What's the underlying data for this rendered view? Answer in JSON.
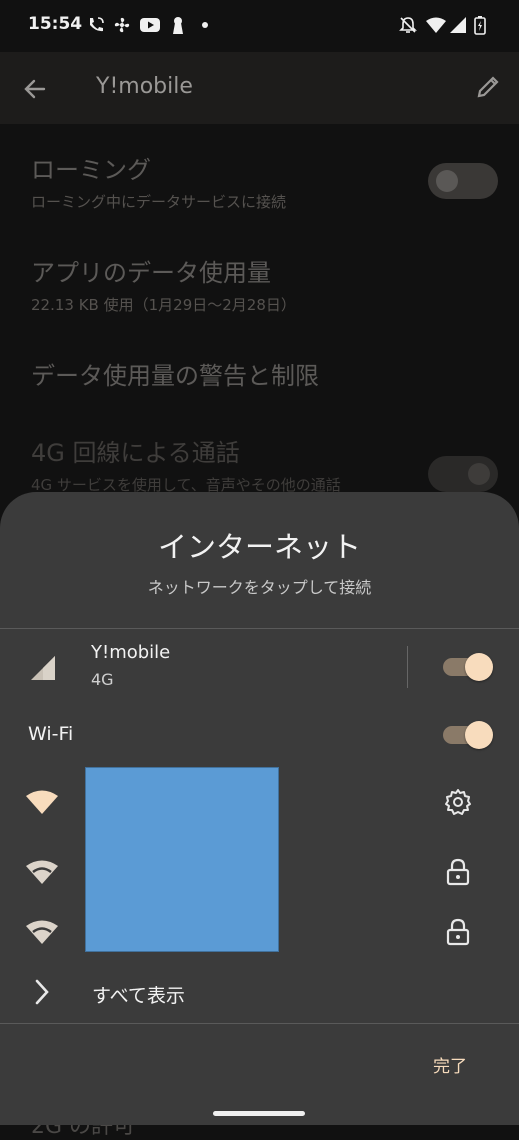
{
  "status_bar": {
    "time": "15:54",
    "left_icons": [
      "wifi-calling-icon",
      "fan-icon",
      "youtube-icon",
      "keyhole-icon",
      "dot-icon"
    ],
    "right_icons": [
      "notifications-off-icon",
      "wifi-icon",
      "cell-signal-icon",
      "battery-charging-icon"
    ]
  },
  "app_bar": {
    "title": "Y!mobile"
  },
  "settings": [
    {
      "title": "ローミング",
      "subtitle": "ローミング中にデータサービスに接続",
      "toggle": false
    },
    {
      "title": "アプリのデータ使用量",
      "subtitle": "22.13 KB 使用（1月29日〜2月28日）"
    },
    {
      "title": "データ使用量の警告と制限"
    },
    {
      "title": "4G 回線による通話",
      "subtitle": "4G サービスを使用して、音声やその他の通話",
      "toggle": true
    }
  ],
  "peek_text": "2G の許可",
  "sheet": {
    "title": "インターネット",
    "subtitle": "ネットワークをタップして接続",
    "carrier": {
      "name": "Y!mobile",
      "network": "4G",
      "enabled": true
    },
    "wifi": {
      "label": "Wi-Fi",
      "enabled": true
    },
    "networks": [
      {
        "icon": "wifi-connected-icon",
        "action_icon": "gear-icon"
      },
      {
        "icon": "wifi-icon",
        "action_icon": "lock-icon"
      },
      {
        "icon": "wifi-icon",
        "action_icon": "lock-icon"
      }
    ],
    "see_all_label": "すべて表示",
    "done_label": "完了"
  },
  "colors": {
    "accent": "#f8dcbd",
    "sheet_bg": "#3b3b3b",
    "redaction": "#5b9bd5"
  }
}
